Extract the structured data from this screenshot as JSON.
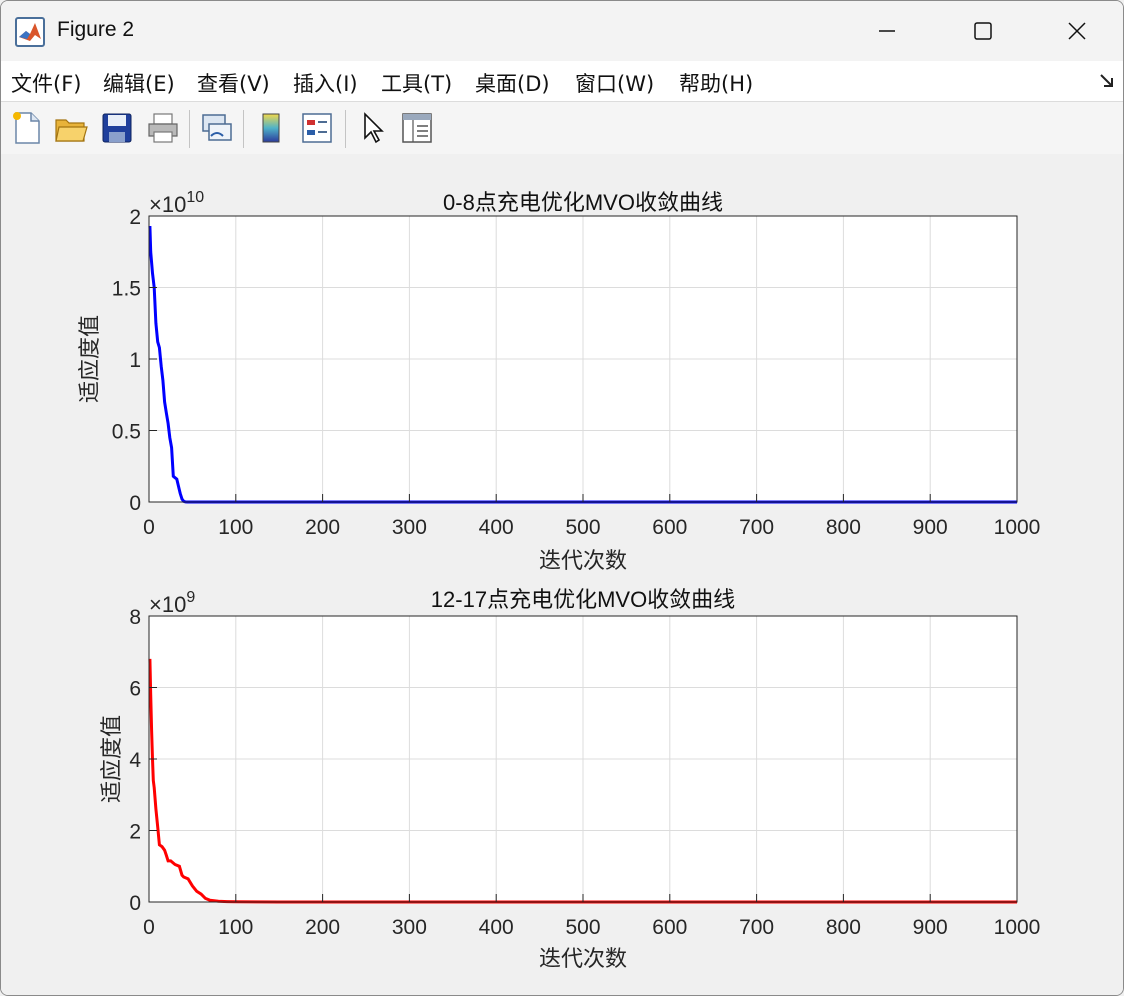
{
  "window": {
    "title": "Figure 2",
    "icon": "matlab-icon",
    "controls": [
      "minimize-icon",
      "maximize-icon",
      "close-icon"
    ]
  },
  "menu": {
    "items": [
      "文件(F)",
      "编辑(E)",
      "查看(V)",
      "插入(I)",
      "工具(T)",
      "桌面(D)",
      "窗口(W)",
      "帮助(H)"
    ],
    "dock_icon": "dock-arrow-icon"
  },
  "toolbar": {
    "buttons": [
      "new-figure-icon",
      "open-file-icon",
      "save-icon",
      "print-icon",
      "link-plot-icon",
      "colorbar-icon",
      "legend-icon",
      "pointer-icon",
      "property-inspector-icon"
    ]
  },
  "chart_data": [
    {
      "type": "line",
      "title": "0-8点充电优化MVO收敛曲线",
      "xlabel": "迭代次数",
      "ylabel": "适应度值",
      "exponent_label": "×10",
      "exponent_value": "10",
      "xlim": [
        0,
        1000
      ],
      "ylim": [
        0,
        2
      ],
      "xticks": [
        "0",
        "100",
        "200",
        "300",
        "400",
        "500",
        "600",
        "700",
        "800",
        "900",
        "1000"
      ],
      "yticks": [
        "0",
        "0.5",
        "1",
        "1.5",
        "2"
      ],
      "grid": true,
      "series": [
        {
          "color": "#0000ff",
          "x": [
            1,
            2,
            4,
            6,
            8,
            10,
            12,
            14,
            16,
            18,
            20,
            22,
            24,
            26,
            28,
            30,
            32,
            34,
            36,
            38,
            40,
            42,
            44,
            46,
            50,
            100,
            200,
            500,
            1000
          ],
          "y": [
            1.93,
            1.75,
            1.6,
            1.5,
            1.25,
            1.12,
            1.08,
            0.95,
            0.85,
            0.7,
            0.62,
            0.55,
            0.45,
            0.38,
            0.18,
            0.17,
            0.16,
            0.11,
            0.06,
            0.02,
            0.005,
            0.001,
            0.0,
            0.0,
            0.0,
            0.0,
            0.0,
            0.0,
            0.0
          ]
        }
      ]
    },
    {
      "type": "line",
      "title": "12-17点充电优化MVO收敛曲线",
      "xlabel": "迭代次数",
      "ylabel": "适应度值",
      "exponent_label": "×10",
      "exponent_value": "9",
      "xlim": [
        0,
        1000
      ],
      "ylim": [
        0,
        8
      ],
      "xticks": [
        "0",
        "100",
        "200",
        "300",
        "400",
        "500",
        "600",
        "700",
        "800",
        "900",
        "1000"
      ],
      "yticks": [
        "0",
        "2",
        "4",
        "6",
        "8"
      ],
      "grid": true,
      "series": [
        {
          "color": "#ff0000",
          "x": [
            1,
            2,
            3,
            4,
            5,
            6,
            8,
            10,
            12,
            15,
            18,
            20,
            22,
            25,
            30,
            35,
            38,
            40,
            45,
            50,
            55,
            60,
            65,
            70,
            80,
            90,
            100,
            150,
            200,
            500,
            1000
          ],
          "y": [
            6.8,
            5.8,
            4.8,
            4.0,
            3.4,
            3.2,
            2.6,
            2.1,
            1.6,
            1.55,
            1.45,
            1.3,
            1.15,
            1.15,
            1.05,
            1.0,
            0.75,
            0.7,
            0.65,
            0.45,
            0.3,
            0.22,
            0.1,
            0.05,
            0.02,
            0.01,
            0.005,
            0.0,
            0.0,
            0.0,
            0.0
          ]
        }
      ]
    }
  ]
}
